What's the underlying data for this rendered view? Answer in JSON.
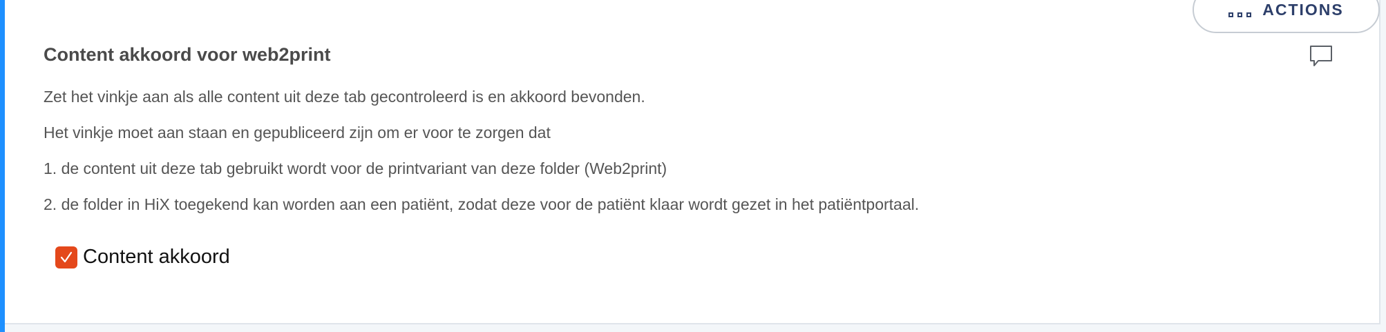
{
  "header": {
    "actions_label": "ACTIONS"
  },
  "section": {
    "title": "Content akkoord voor web2print",
    "paragraphs": [
      "Zet het vinkje aan als alle content uit deze tab gecontroleerd is en akkoord bevonden.",
      "Het vinkje moet aan staan en gepubliceerd zijn om er voor te zorgen dat",
      "1. de content uit deze tab gebruikt wordt voor de printvariant van deze folder (Web2print)",
      "2. de folder in HiX toegekend kan worden aan een patiënt, zodat deze voor de patiënt klaar wordt gezet in het patiëntportaal."
    ],
    "checkbox": {
      "label": "Content akkoord",
      "checked": true
    }
  },
  "icons": {
    "actions": "dots-icon",
    "comment": "comment-icon",
    "check": "checkmark-icon"
  },
  "colors": {
    "accent_left": "#1e90ff",
    "checkbox": "#e4481b",
    "actions_text": "#2d3f6a",
    "text": "#4a4a4a"
  }
}
